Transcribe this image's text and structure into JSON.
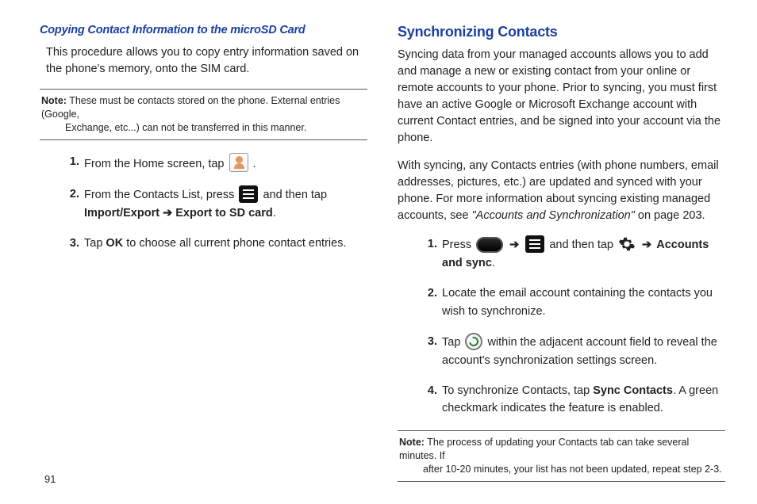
{
  "left": {
    "subhead": "Copying Contact Information to the microSD Card",
    "intro": "This procedure allows you to copy entry information saved on the phone's memory, onto the SIM card.",
    "note_label": "Note:",
    "note_line1": " These must be contacts stored on the phone. External entries (Google,",
    "note_line2": "Exchange, etc...) can not be transferred in this manner.",
    "step1_a": "From the Home screen, tap ",
    "step1_b": ".",
    "step2_a": "From the Contacts List, press ",
    "step2_b": " and then tap ",
    "step2_bold": "Import/Export ➔ Export to SD card",
    "step2_c": ".",
    "step3_a": "Tap ",
    "step3_bold": "OK",
    "step3_b": "  to choose all current phone contact entries."
  },
  "right": {
    "head": "Synchronizing Contacts",
    "p1": "Syncing data from your managed accounts allows you to add and manage a new or existing contact from your online or remote accounts to your phone. Prior to syncing, you must first have an active Google or Microsoft Exchange account with current Contact entries, and be signed into your account via the phone.",
    "p2_a": "With syncing, any Contacts entries (with phone numbers, email addresses, pictures, etc.) are updated and synced with your phone. For more information about syncing existing managed accounts, see ",
    "p2_i": "\"Accounts and Synchronization\"",
    "p2_b": " on page 203.",
    "step1_a": "Press ",
    "step1_arrow1": " ➔ ",
    "step1_b": " and then tap ",
    "step1_arrow2": " ➔ ",
    "step1_bold": "Accounts and sync",
    "step1_c": ".",
    "step2": "Locate the email account containing the contacts you wish to synchronize.",
    "step3_a": "Tap ",
    "step3_b": " within the adjacent account field to reveal the account's synchronization settings screen.",
    "step4_a": "To synchronize Contacts, tap ",
    "step4_bold": "Sync Contacts",
    "step4_b": ". A green checkmark indicates the feature is enabled.",
    "note_label": "Note:",
    "note_line1": " The process of updating your Contacts tab can take several minutes. If",
    "note_line2": "after 10-20 minutes, your list has not been updated, repeat step 2-3."
  },
  "page_number": "91"
}
